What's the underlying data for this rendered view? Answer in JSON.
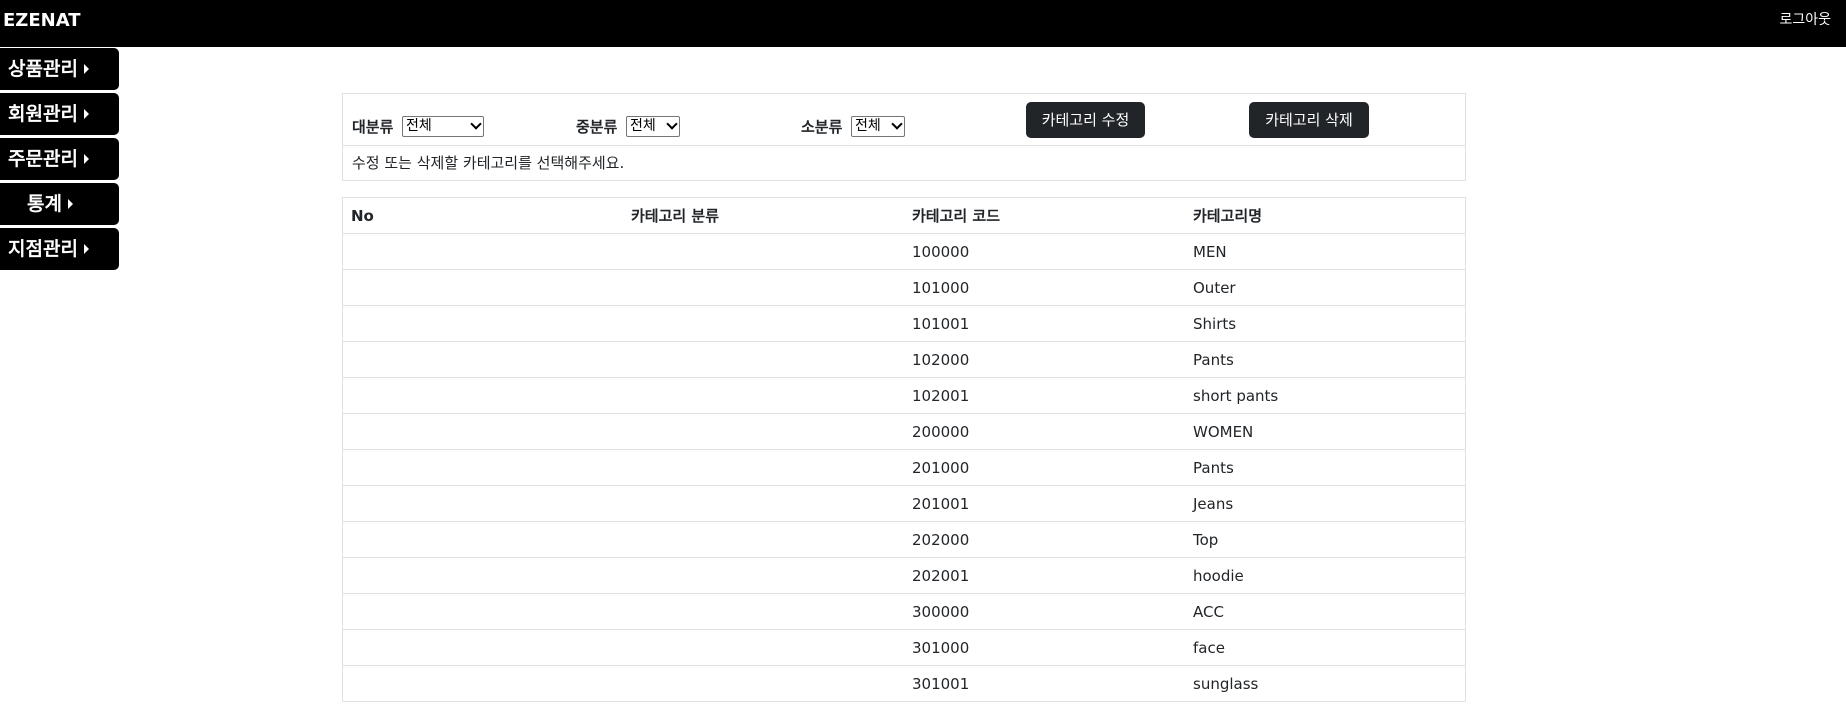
{
  "header": {
    "brand": "EZENAT",
    "logout": "로그아웃"
  },
  "sidebar": {
    "items": [
      {
        "label": "상품관리"
      },
      {
        "label": "회원관리"
      },
      {
        "label": "주문관리"
      },
      {
        "label": "통계"
      },
      {
        "label": "지점관리"
      }
    ]
  },
  "filters": {
    "major_label": "대분류",
    "major_value": "전체",
    "middle_label": "중분류",
    "middle_value": "전체",
    "minor_label": "소분류",
    "minor_value": "전체",
    "edit_button": "카테고리 수정",
    "delete_button": "카테고리 삭제",
    "hint": "수정 또는 삭제할 카테고리를 선택해주세요."
  },
  "table": {
    "columns": [
      "No",
      "카테고리 분류",
      "카테고리 코드",
      "카테고리명"
    ],
    "rows": [
      {
        "no": "",
        "type": "",
        "code": "100000",
        "name": "MEN"
      },
      {
        "no": "",
        "type": "",
        "code": "101000",
        "name": "Outer"
      },
      {
        "no": "",
        "type": "",
        "code": "101001",
        "name": "Shirts"
      },
      {
        "no": "",
        "type": "",
        "code": "102000",
        "name": "Pants"
      },
      {
        "no": "",
        "type": "",
        "code": "102001",
        "name": "short pants"
      },
      {
        "no": "",
        "type": "",
        "code": "200000",
        "name": "WOMEN"
      },
      {
        "no": "",
        "type": "",
        "code": "201000",
        "name": "Pants"
      },
      {
        "no": "",
        "type": "",
        "code": "201001",
        "name": "Jeans"
      },
      {
        "no": "",
        "type": "",
        "code": "202000",
        "name": "Top"
      },
      {
        "no": "",
        "type": "",
        "code": "202001",
        "name": "hoodie"
      },
      {
        "no": "",
        "type": "",
        "code": "300000",
        "name": "ACC"
      },
      {
        "no": "",
        "type": "",
        "code": "301000",
        "name": "face"
      },
      {
        "no": "",
        "type": "",
        "code": "301001",
        "name": "sunglass"
      }
    ]
  }
}
